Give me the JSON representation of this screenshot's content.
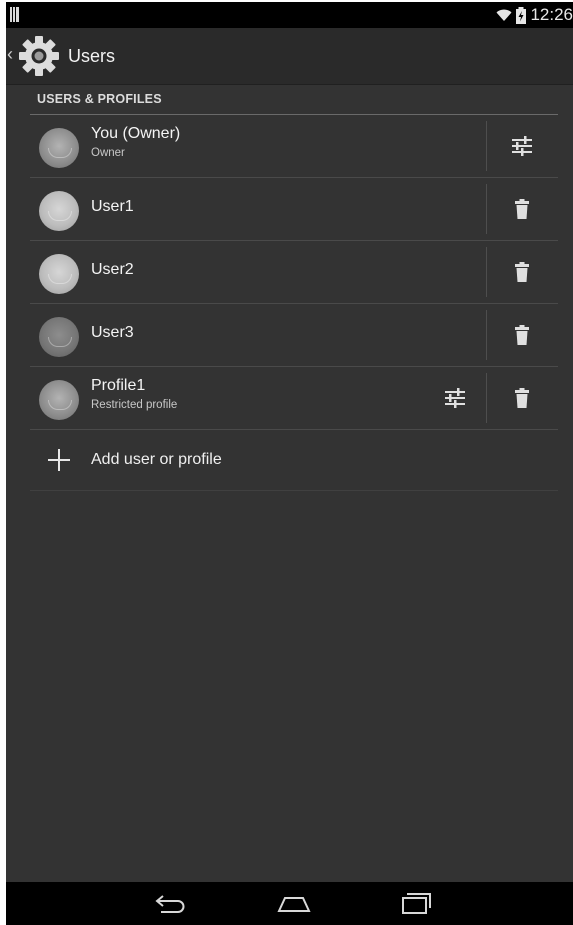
{
  "status_bar": {
    "time": "12:26"
  },
  "action_bar": {
    "title": "Users"
  },
  "section": {
    "header": "USERS & PROFILES"
  },
  "users": [
    {
      "name": "You (Owner)",
      "subtitle": "Owner",
      "action": "settings-sliders-icon"
    },
    {
      "name": "User1",
      "action": "trash-icon"
    },
    {
      "name": "User2",
      "action": "trash-icon"
    },
    {
      "name": "User3",
      "action": "trash-icon"
    },
    {
      "name": "Profile1",
      "subtitle": "Restricted profile",
      "action": "trash-icon",
      "secondary_action": "settings-sliders-icon"
    }
  ],
  "add_action": {
    "label": "Add user or profile"
  },
  "nav": {
    "buttons": [
      "back-icon",
      "home-icon",
      "recents-icon"
    ]
  }
}
